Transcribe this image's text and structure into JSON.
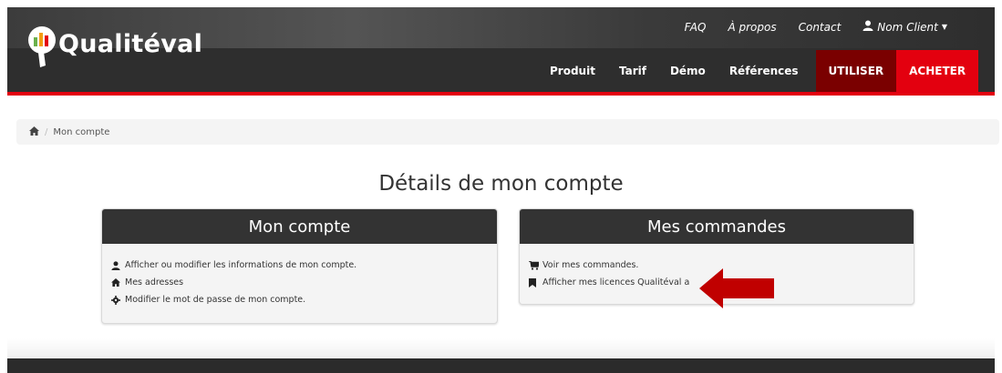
{
  "brand": {
    "name": "Qualitéval",
    "logo_initial": "Q"
  },
  "top_links": [
    {
      "label": "FAQ"
    },
    {
      "label": "À propos"
    },
    {
      "label": "Contact"
    }
  ],
  "user_menu": {
    "label": "Nom Client"
  },
  "main_nav": [
    {
      "label": "Produit"
    },
    {
      "label": "Tarif"
    },
    {
      "label": "Démo"
    },
    {
      "label": "Références"
    }
  ],
  "cta": {
    "utiliser": "UTILISER",
    "acheter": "ACHETER"
  },
  "breadcrumb": {
    "current": "Mon compte",
    "separator": "/"
  },
  "page_title": "Détails de mon compte",
  "account_panel": {
    "title": "Mon compte",
    "links": [
      {
        "icon": "user-icon",
        "label": "Afficher ou modifier les informations de mon compte."
      },
      {
        "icon": "home-icon",
        "label": "Mes adresses"
      },
      {
        "icon": "gear-icon",
        "label": "Modifier le mot de passe de mon compte."
      }
    ]
  },
  "orders_panel": {
    "title": "Mes commandes",
    "links": [
      {
        "icon": "cart-icon",
        "label": "Voir mes commandes."
      },
      {
        "icon": "bookmark-icon",
        "label": "Afficher mes licences Qualitéval a"
      }
    ]
  },
  "colors": {
    "accent_red": "#e3000f",
    "dark_red": "#7a0000",
    "nav_dark": "#2e2e2e",
    "panel_head": "#333333",
    "arrow": "#c00000"
  }
}
